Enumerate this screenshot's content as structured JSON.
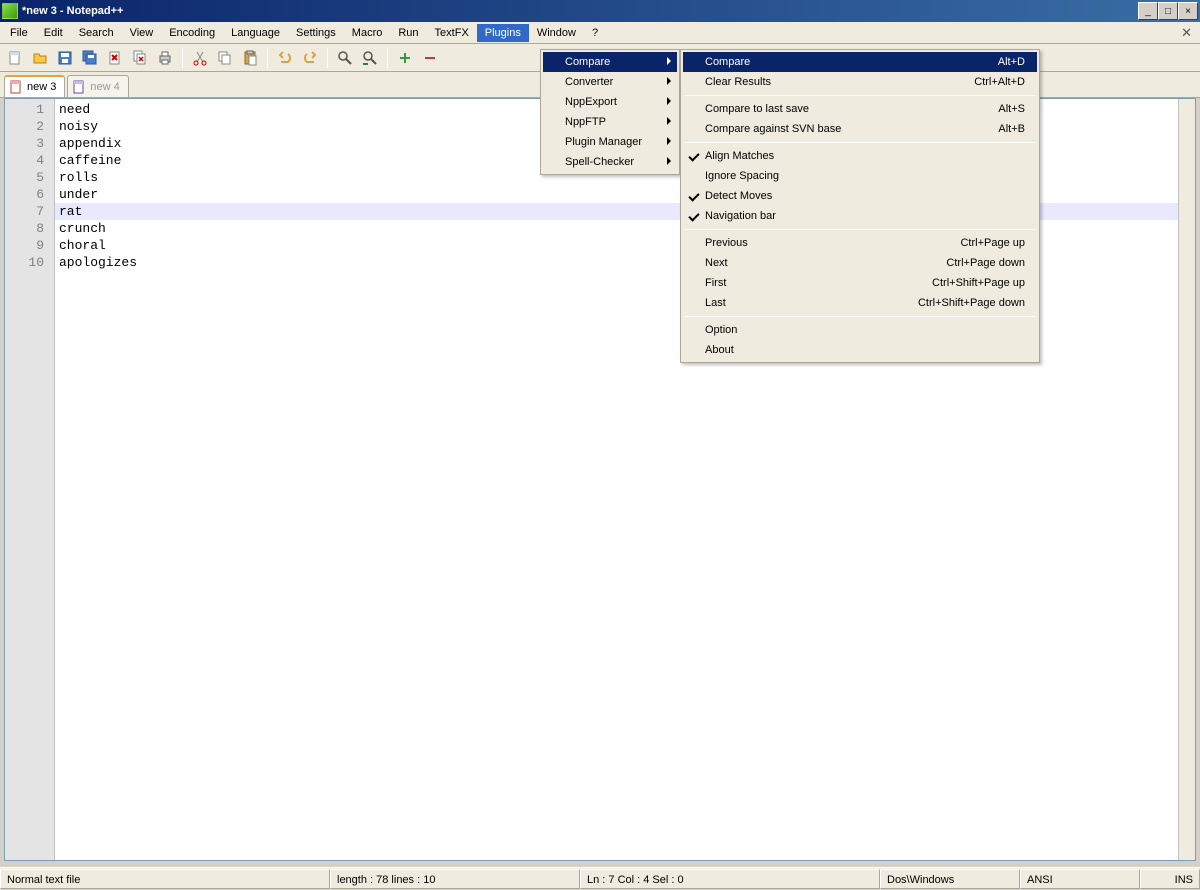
{
  "title": "*new  3 - Notepad++",
  "menu": [
    "File",
    "Edit",
    "Search",
    "View",
    "Encoding",
    "Language",
    "Settings",
    "Macro",
    "Run",
    "TextFX",
    "Plugins",
    "Window",
    "?"
  ],
  "tabs": [
    {
      "label": "new  3",
      "active": true
    },
    {
      "label": "new  4",
      "active": false
    }
  ],
  "lines": [
    "need",
    "noisy",
    "appendix",
    "caffeine",
    "rolls",
    "under",
    "rat",
    "crunch",
    "choral",
    "apologizes"
  ],
  "caret_line": 7,
  "plugins_menu": [
    {
      "label": "Compare",
      "highlight": true,
      "arrow": true
    },
    {
      "label": "Converter",
      "arrow": true
    },
    {
      "label": "NppExport",
      "arrow": true
    },
    {
      "label": "NppFTP",
      "arrow": true
    },
    {
      "label": "Plugin Manager",
      "arrow": true
    },
    {
      "label": "Spell-Checker",
      "arrow": true
    }
  ],
  "compare_submenu": [
    {
      "label": "Compare",
      "shortcut": "Alt+D",
      "highlight": true
    },
    {
      "label": "Clear Results",
      "shortcut": "Ctrl+Alt+D"
    },
    {
      "sep": true
    },
    {
      "label": "Compare to last save",
      "shortcut": "Alt+S"
    },
    {
      "label": "Compare against SVN base",
      "shortcut": "Alt+B"
    },
    {
      "sep": true
    },
    {
      "label": "Align Matches",
      "check": true
    },
    {
      "label": "Ignore Spacing"
    },
    {
      "label": "Detect Moves",
      "check": true
    },
    {
      "label": "Navigation bar",
      "check": true
    },
    {
      "sep": true
    },
    {
      "label": "Previous",
      "shortcut": "Ctrl+Page up"
    },
    {
      "label": "Next",
      "shortcut": "Ctrl+Page down"
    },
    {
      "label": "First",
      "shortcut": "Ctrl+Shift+Page up"
    },
    {
      "label": "Last",
      "shortcut": "Ctrl+Shift+Page down"
    },
    {
      "sep": true
    },
    {
      "label": "Option"
    },
    {
      "label": "About"
    }
  ],
  "status": {
    "filetype": "Normal text file",
    "length": "length : 78    lines : 10",
    "pos": "Ln : 7    Col : 4    Sel : 0",
    "eol": "Dos\\Windows",
    "enc": "ANSI",
    "ins": "INS"
  }
}
